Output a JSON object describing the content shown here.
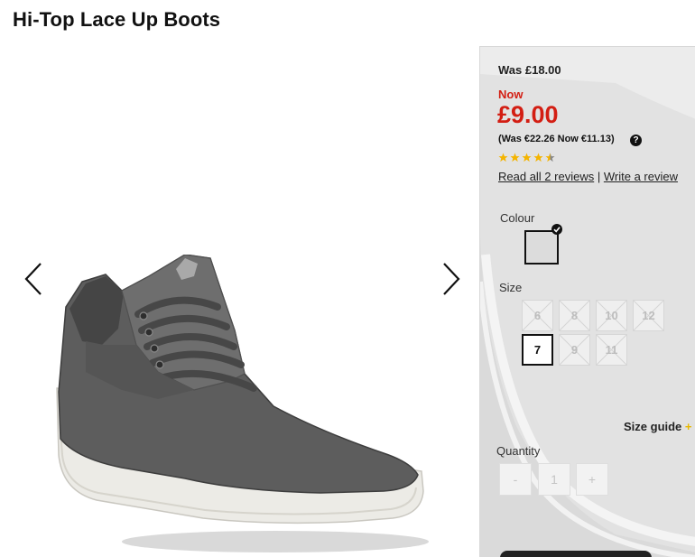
{
  "product": {
    "title": "Hi-Top Lace Up Boots"
  },
  "gallery": {
    "prev_icon": "chevron-left-icon",
    "next_icon": "chevron-right-icon"
  },
  "pricing": {
    "was": "Was £18.00",
    "now_label": "Now",
    "now_price": "£9.00",
    "euro": "(Was €22.26 Now €11.13)",
    "help_icon": "?"
  },
  "rating": {
    "value": 4.5,
    "max": 5
  },
  "reviews": {
    "read_all": "Read all 2 reviews",
    "separator": "|",
    "write": "Write a review"
  },
  "colour": {
    "label": "Colour",
    "selected_swatch": "#dcdcdc"
  },
  "size": {
    "label": "Size",
    "options": [
      {
        "label": "6",
        "available": false,
        "selected": false
      },
      {
        "label": "8",
        "available": false,
        "selected": false
      },
      {
        "label": "10",
        "available": false,
        "selected": false
      },
      {
        "label": "12",
        "available": false,
        "selected": false
      },
      {
        "label": "7",
        "available": true,
        "selected": true
      },
      {
        "label": "9",
        "available": false,
        "selected": false
      },
      {
        "label": "11",
        "available": false,
        "selected": false
      }
    ],
    "guide_label": "Size guide",
    "guide_icon": "+"
  },
  "quantity": {
    "label": "Quantity",
    "minus": "-",
    "value": "1",
    "plus": "+"
  },
  "colors": {
    "price_red": "#d31e13",
    "star_gold": "#f4b400",
    "panel_bg": "#e4e4e4"
  }
}
